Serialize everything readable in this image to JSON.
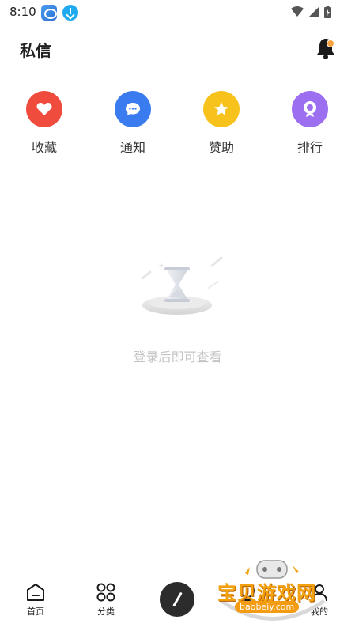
{
  "status_bar": {
    "time": "8:10",
    "icons": [
      "app-icon",
      "download-icon",
      "wifi-icon",
      "signal-icon",
      "battery-icon"
    ]
  },
  "header": {
    "title": "私信",
    "notification_icon": "bell-icon",
    "badge_color": "#f4a340"
  },
  "actions": [
    {
      "label": "收藏",
      "icon": "heart-icon",
      "color": "#f04c3e"
    },
    {
      "label": "通知",
      "icon": "chat-bubble-icon",
      "color": "#3a7cf0"
    },
    {
      "label": "赞助",
      "icon": "star-icon",
      "color": "#f7c21c"
    },
    {
      "label": "排行",
      "icon": "medal-icon",
      "color": "#9b6ff0"
    }
  ],
  "empty_state": {
    "illustration": "hourglass-icon",
    "message": "登录后即可查看"
  },
  "tabs": [
    {
      "label": "首页",
      "icon": "home-icon"
    },
    {
      "label": "分类",
      "icon": "grid-icon"
    },
    {
      "label": "",
      "icon": "compose-icon"
    },
    {
      "label": "",
      "icon": "bulb-icon"
    },
    {
      "label": "我的",
      "icon": "person-icon"
    }
  ],
  "watermark": {
    "text": "宝贝游戏网",
    "url": "baobeiy.com"
  }
}
